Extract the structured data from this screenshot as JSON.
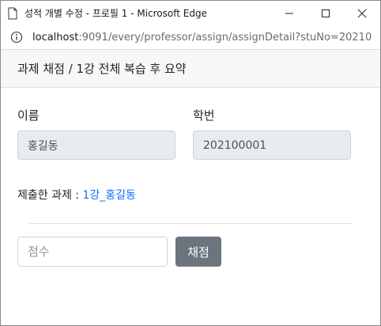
{
  "window": {
    "title": "성적 개별 수정 - 프로필 1 - Microsoft Edge"
  },
  "address": {
    "host": "localhost",
    "path": ":9091/every/professor/assign/assignDetail?stuNo=20210..."
  },
  "modal": {
    "title": "과제 채점 / 1강 전체 복습 후 요약"
  },
  "form": {
    "name_label": "이름",
    "name_value": "홍길동",
    "student_no_label": "학번",
    "student_no_value": "202100001",
    "submitted_label": "제출한 과제 : ",
    "submitted_link": "1강_홍길동",
    "score_placeholder": "점수",
    "grade_button": "채점"
  }
}
